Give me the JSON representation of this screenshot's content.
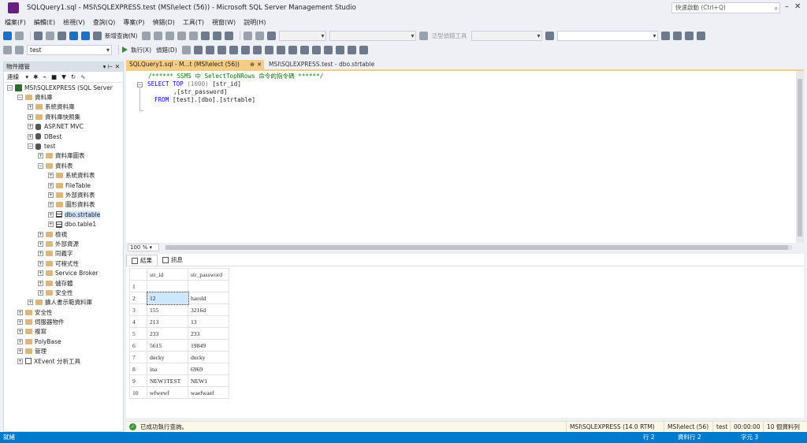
{
  "window": {
    "title": "SQLQuery1.sql - MSI\\SQLEXPRESS.test (MSI\\elect (56)) - Microsoft SQL Server Management Studio",
    "quick_launch_placeholder": "快速啟動 (Ctrl+Q)"
  },
  "menu": [
    "檔案(F)",
    "編輯(E)",
    "檢視(V)",
    "查詢(Q)",
    "專案(P)",
    "偵錯(D)",
    "工具(T)",
    "視窗(W)",
    "說明(H)"
  ],
  "toolbar1": {
    "new_query": "新增查詢(N)",
    "generic_debugger": "泛型偵錯工具"
  },
  "toolbar2": {
    "database": "test",
    "execute": "執行(X)",
    "debug": "偵錯(D)"
  },
  "object_explorer": {
    "title": "物件總管",
    "connect": "連線",
    "tree": [
      {
        "indent": 0,
        "exp": "⊟",
        "icon": "server",
        "label": "MSI\\SQLEXPRESS (SQL Server"
      },
      {
        "indent": 1,
        "exp": "⊟",
        "icon": "folder",
        "label": "資料庫"
      },
      {
        "indent": 2,
        "exp": "⊞",
        "icon": "folder",
        "label": "系統資料庫"
      },
      {
        "indent": 2,
        "exp": "⊞",
        "icon": "folder",
        "label": "資料庫快照集"
      },
      {
        "indent": 2,
        "exp": "⊞",
        "icon": "db",
        "label": "ASP.NET MVC"
      },
      {
        "indent": 2,
        "exp": "⊞",
        "icon": "db",
        "label": "DBest"
      },
      {
        "indent": 2,
        "exp": "⊟",
        "icon": "db",
        "label": "test"
      },
      {
        "indent": 3,
        "exp": "⊞",
        "icon": "folder",
        "label": "資料庫圖表"
      },
      {
        "indent": 3,
        "exp": "⊟",
        "icon": "folder",
        "label": "資料表"
      },
      {
        "indent": 4,
        "exp": "⊞",
        "icon": "folder",
        "label": "系統資料表"
      },
      {
        "indent": 4,
        "exp": "⊞",
        "icon": "folder",
        "label": "FileTable"
      },
      {
        "indent": 4,
        "exp": "⊞",
        "icon": "folder",
        "label": "外部資料表"
      },
      {
        "indent": 4,
        "exp": "⊞",
        "icon": "folder",
        "label": "圖形資料表"
      },
      {
        "indent": 4,
        "exp": "⊞",
        "icon": "table",
        "label": "dbo.strtable",
        "selected": true
      },
      {
        "indent": 4,
        "exp": "⊞",
        "icon": "table",
        "label": "dbo.table1"
      },
      {
        "indent": 3,
        "exp": "⊞",
        "icon": "folder",
        "label": "檢視"
      },
      {
        "indent": 3,
        "exp": "⊞",
        "icon": "folder",
        "label": "外部資源"
      },
      {
        "indent": 3,
        "exp": "⊞",
        "icon": "folder",
        "label": "同義字"
      },
      {
        "indent": 3,
        "exp": "⊞",
        "icon": "folder",
        "label": "可程式性"
      },
      {
        "indent": 3,
        "exp": "⊞",
        "icon": "folder",
        "label": "Service Broker"
      },
      {
        "indent": 3,
        "exp": "⊞",
        "icon": "folder",
        "label": "儲存體"
      },
      {
        "indent": 3,
        "exp": "⊞",
        "icon": "folder",
        "label": "安全性"
      },
      {
        "indent": 2,
        "exp": "⊞",
        "icon": "folder",
        "label": "擴人書示範資料庫"
      },
      {
        "indent": 1,
        "exp": "⊞",
        "icon": "folder",
        "label": "安全性"
      },
      {
        "indent": 1,
        "exp": "⊞",
        "icon": "folder",
        "label": "伺服器物件"
      },
      {
        "indent": 1,
        "exp": "⊞",
        "icon": "folder",
        "label": "複寫"
      },
      {
        "indent": 1,
        "exp": "⊞",
        "icon": "folder",
        "label": "PolyBase"
      },
      {
        "indent": 1,
        "exp": "⊞",
        "icon": "folder",
        "label": "管理"
      },
      {
        "indent": 1,
        "exp": "⊞",
        "icon": "xevent",
        "label": "XEvent 分析工具"
      }
    ]
  },
  "tabs": {
    "active": "SQLQuery1.sql - M...t (MSI\\elect (56))",
    "inactive": "MSI\\SQLEXPRESS.test - dbo.strtable"
  },
  "editor": {
    "comment": "/****** SSMS 中 SelectTopNRows 命令的指令碼  ******/",
    "select": "SELECT TOP",
    "top_n": "(1000)",
    "col1": "[str_id]",
    "col2": ",[str_password]",
    "from": "FROM",
    "table": "[test].[dbo].[strtable]",
    "zoom": "100 %"
  },
  "results": {
    "tab_results": "結果",
    "tab_messages": "訊息",
    "columns": [
      "str_id",
      "str_password"
    ],
    "rows": [
      [
        "1",
        "",
        ""
      ],
      [
        "2",
        "12",
        "harold"
      ],
      [
        "3",
        "155",
        "3216d"
      ],
      [
        "4",
        "213",
        "13"
      ],
      [
        "5",
        "233",
        "233"
      ],
      [
        "6",
        "5615",
        "19849"
      ],
      [
        "7",
        "ducky",
        "ducky"
      ],
      [
        "8",
        "ina",
        "6969"
      ],
      [
        "9",
        "NEW1TEST",
        "NEW1"
      ],
      [
        "10",
        "wfwewf",
        "waefwaef"
      ]
    ]
  },
  "status": {
    "message": "已成功執行查詢。",
    "server": "MSI\\SQLEXPRESS (14.0 RTM)",
    "user": "MSI\\elect (56)",
    "db": "test",
    "time": "00:00:00",
    "rows": "10 個資料列"
  },
  "app_status": {
    "left": "就緒",
    "line": "行 2",
    "col": "資料行 2",
    "ch": "字元 3"
  }
}
